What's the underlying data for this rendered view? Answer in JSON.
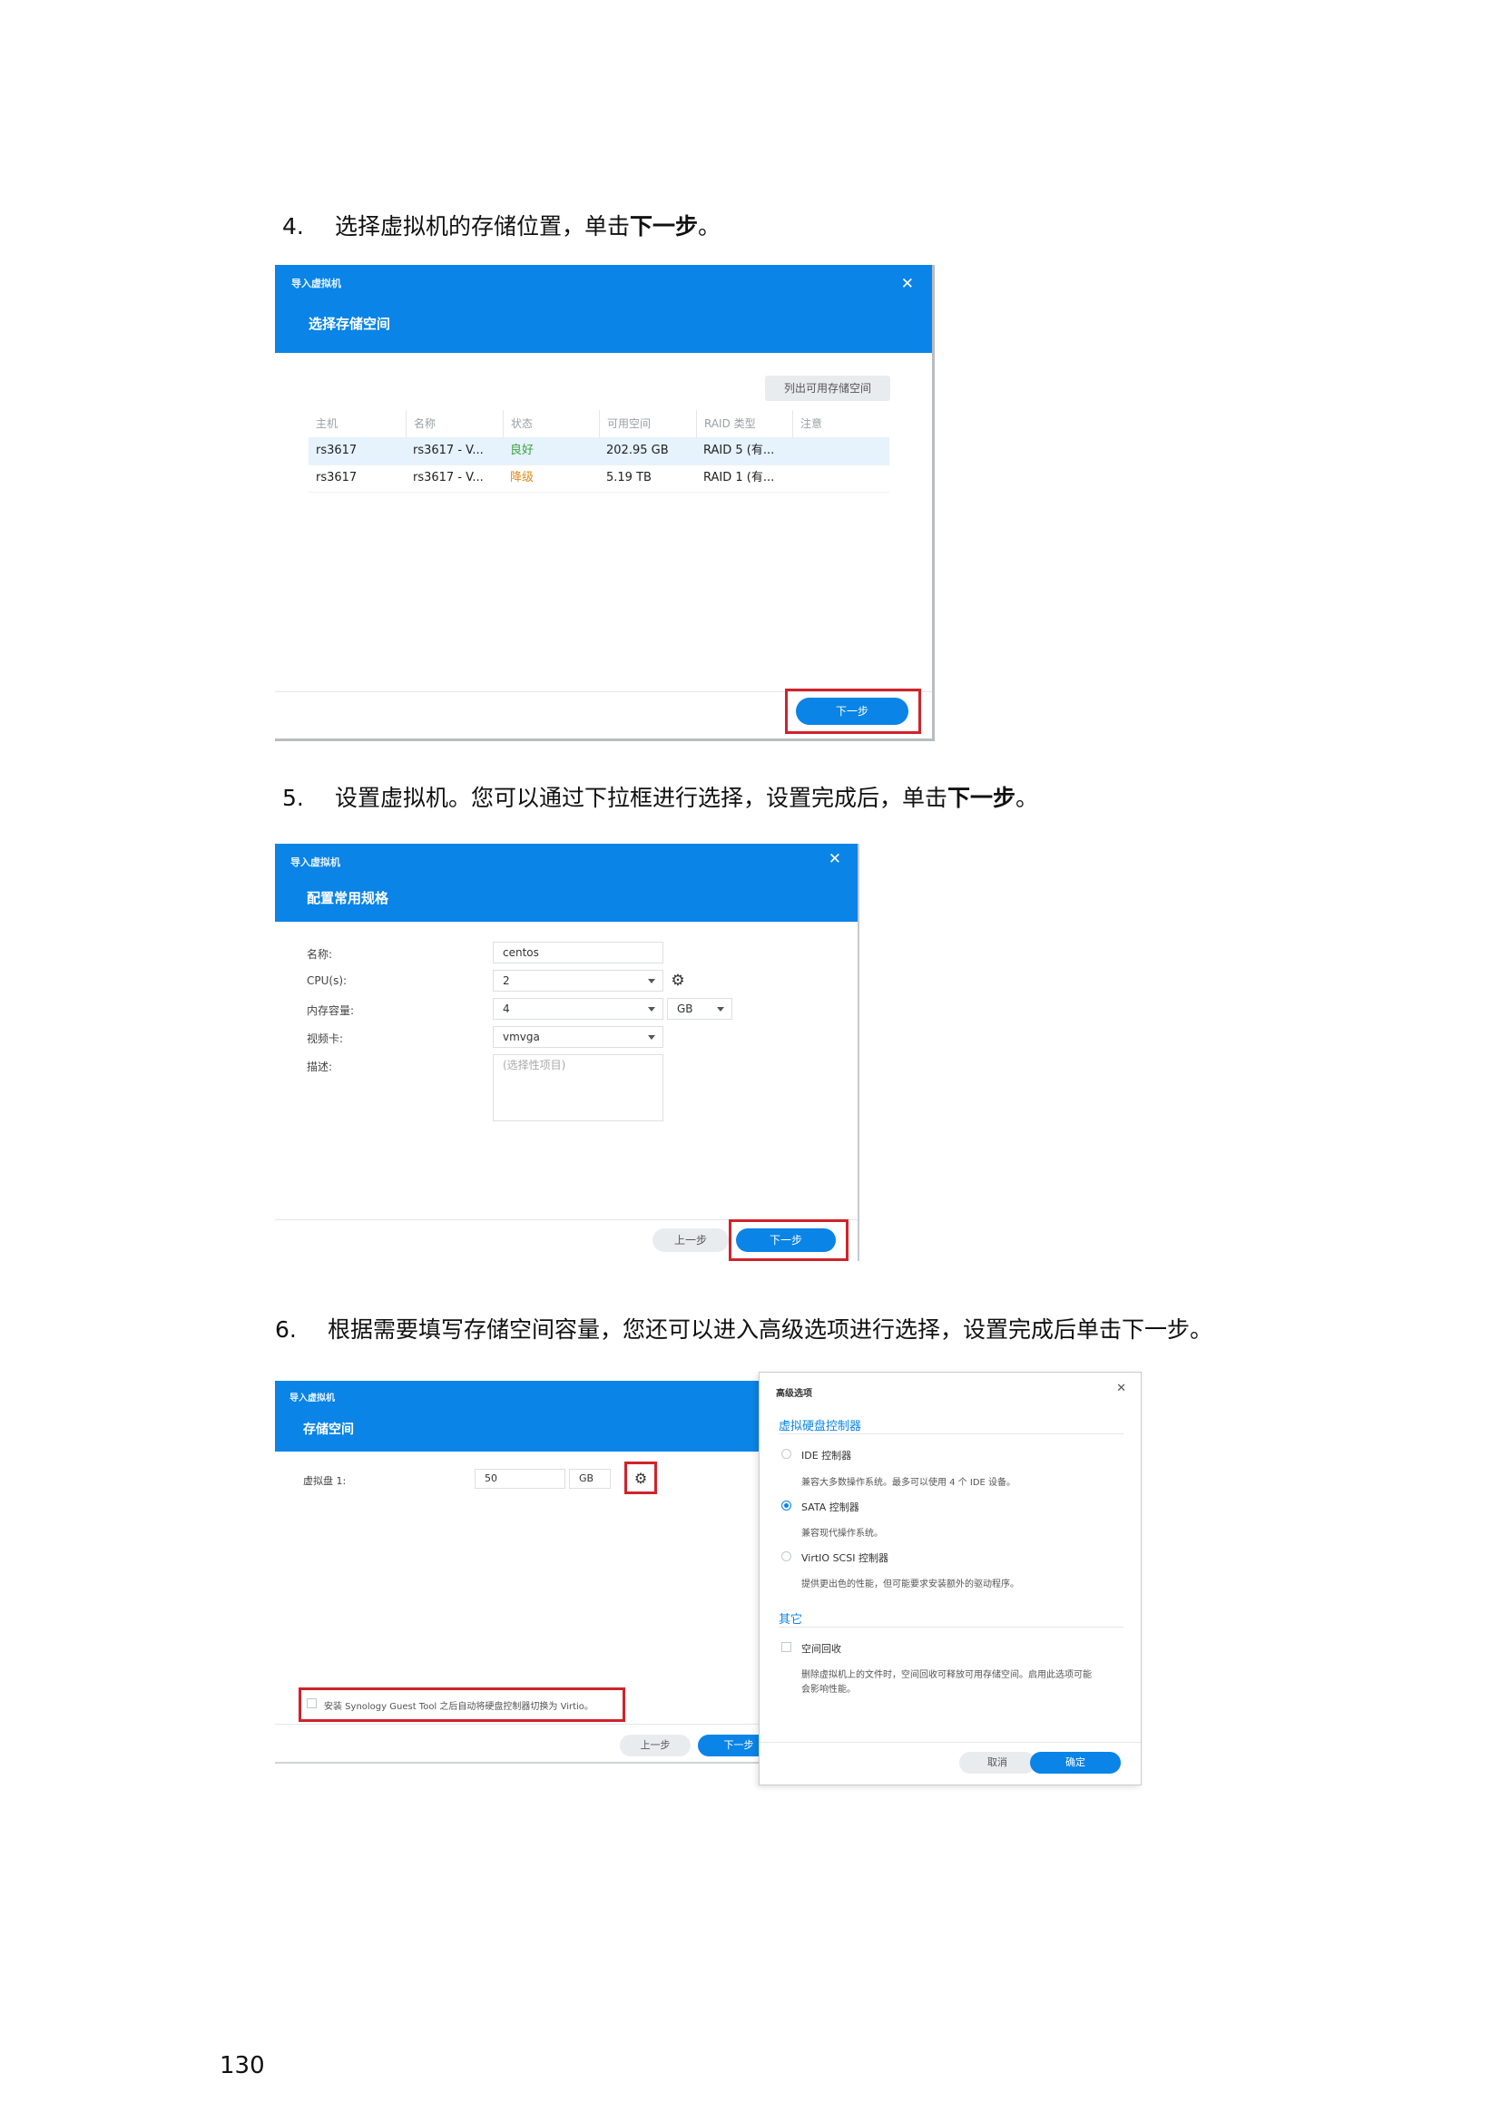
{
  "steps": {
    "s4": {
      "num": "4.",
      "text_before": "选择虚拟机的存储位置，单击",
      "bold": "下一步",
      "text_after": "。"
    },
    "s5": {
      "num": "5.",
      "text_before": "设置虚拟机。您可以通过下拉框进行选择，设置完成后，单击",
      "bold": "下一步",
      "text_after": "。"
    },
    "s6": {
      "num": "6.",
      "text": "根据需要填写存储空间容量，您还可以进入高级选项进行选择，设置完成后单击下一步。"
    }
  },
  "shot1": {
    "app_title": "导入虚拟机",
    "dialog_title": "选择存储空间",
    "list_button": "列出可用存储空间",
    "columns": [
      "主机",
      "名称",
      "状态",
      "可用空间",
      "RAID 类型",
      "注意"
    ],
    "rows": [
      {
        "host": "rs3617",
        "name": "rs3617 - V...",
        "status": "良好",
        "free": "202.95 GB",
        "raid": "RAID 5 (有...",
        "note": ""
      },
      {
        "host": "rs3617",
        "name": "rs3617 - V...",
        "status": "降级",
        "free": "5.19 TB",
        "raid": "RAID 1 (有...",
        "note": ""
      }
    ],
    "next_button": "下一步",
    "colors": {
      "good": "#3aa340",
      "degraded": "#e08a1e",
      "selected_row": "#e6f2fc"
    }
  },
  "shot2": {
    "app_title": "导入虚拟机",
    "dialog_title": "配置常用规格",
    "fields": {
      "name_label": "名称:",
      "name_value": "centos",
      "cpu_label": "CPU(s):",
      "cpu_value": "2",
      "mem_label": "内存容量:",
      "mem_value": "4",
      "mem_unit": "GB",
      "video_label": "视频卡:",
      "video_value": "vmvga",
      "desc_label": "描述:",
      "desc_placeholder": "(选择性项目)"
    },
    "prev_button": "上一步",
    "next_button": "下一步"
  },
  "shot3": {
    "app_title": "导入虚拟机",
    "dialog_title": "存储空间",
    "disk_label": "虚拟盘 1:",
    "disk_size": "50",
    "disk_unit": "GB",
    "guest_tool_text": "安装 Synology Guest Tool 之后自动将硬盘控制器切换为 Virtio。",
    "prev_button": "上一步",
    "next_button": "下一步"
  },
  "advanced": {
    "title": "高级选项",
    "section1_title": "虚拟硬盘控制器",
    "options": [
      {
        "label": "IDE 控制器",
        "desc": "兼容大多数操作系统。最多可以使用 4 个 IDE 设备。",
        "selected": false
      },
      {
        "label": "SATA 控制器",
        "desc": "兼容现代操作系统。",
        "selected": true
      },
      {
        "label": "VirtIO SCSI 控制器",
        "desc": "提供更出色的性能，但可能要求安装额外的驱动程序。",
        "selected": false
      }
    ],
    "section2_title": "其它",
    "reclaim_label": "空间回收",
    "reclaim_desc1": "删除虚拟机上的文件时，空间回收可释放可用存储空间。启用此选项可能",
    "reclaim_desc2": "会影响性能。",
    "cancel_button": "取消",
    "ok_button": "确定"
  },
  "page_number": "130"
}
